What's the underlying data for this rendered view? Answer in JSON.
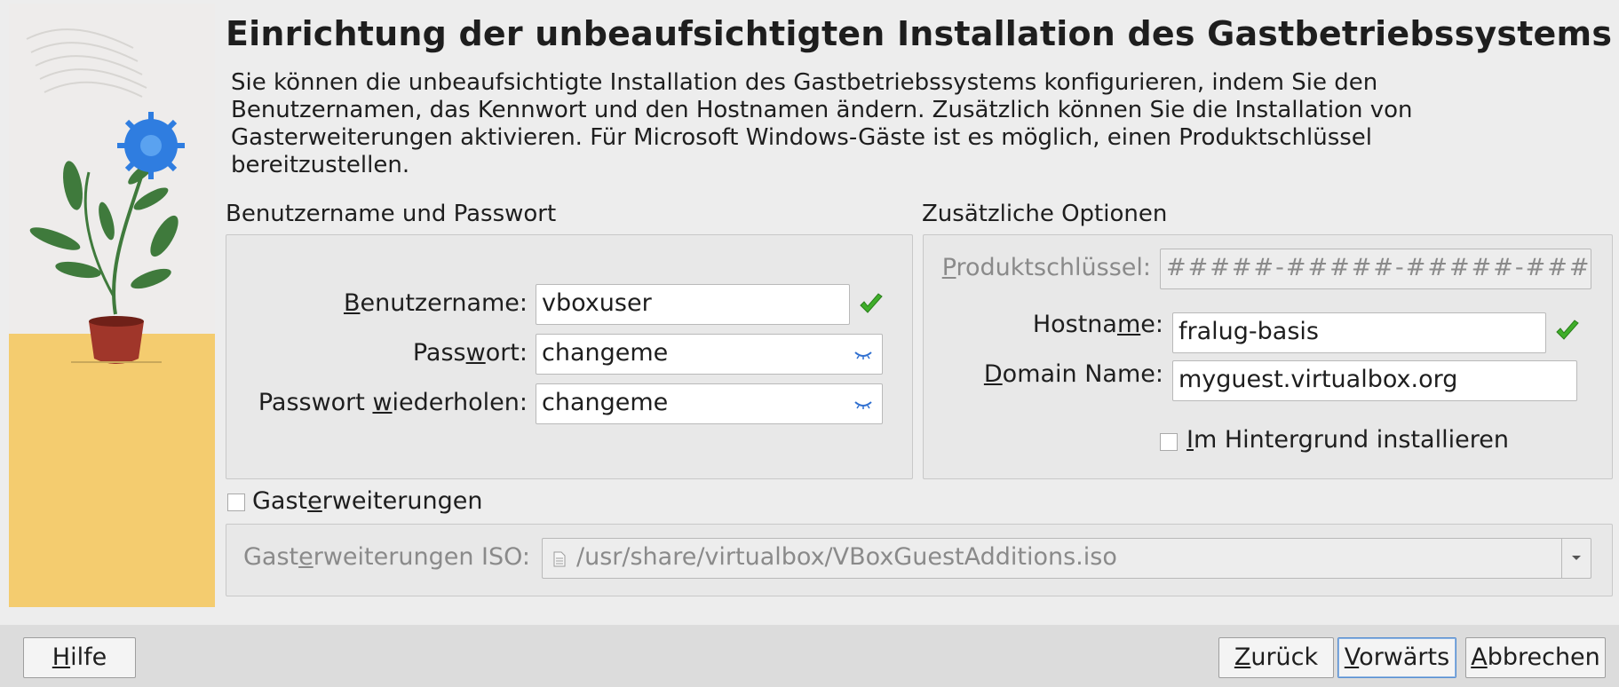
{
  "header": {
    "title": "Einrichtung der unbeaufsichtigten Installation des Gastbetriebssystems",
    "description": "Sie können die unbeaufsichtigte Installation des Gastbetriebssystems konfigurieren, indem Sie den Benutzernamen, das Kennwort und den Hostnamen ändern. Zusätzlich können Sie die Installation von Gasterweiterungen aktivieren. Für Microsoft Windows-Gäste ist es möglich, einen Produktschlüssel bereitzustellen."
  },
  "credentials": {
    "section_label": "Benutzername und Passwort",
    "username_label_prefix": "",
    "username_label_mnemonic": "B",
    "username_label_rest": "enutzername:",
    "username_value": "vboxuser",
    "password_label_prefix": "Pass",
    "password_label_mnemonic": "w",
    "password_label_rest": "ort:",
    "password_value": "changeme",
    "repeat_label_prefix": "Passwort ",
    "repeat_label_mnemonic": "w",
    "repeat_label_rest": "iederholen:",
    "repeat_value": "changeme"
  },
  "options": {
    "section_label": "Zusätzliche Optionen",
    "product_key_label_prefix": "",
    "product_key_label_mnemonic": "P",
    "product_key_label_rest": "roduktschlüssel:",
    "product_key_placeholder": "#####-#####-#####-#####-#####",
    "hostname_label_prefix": "Hostna",
    "hostname_label_mnemonic": "m",
    "hostname_label_rest": "e:",
    "hostname_value": "fralug-basis",
    "domain_label_prefix": "",
    "domain_label_mnemonic": "D",
    "domain_label_rest": "omain Name:",
    "domain_value": "myguest.virtualbox.org",
    "background_label_prefix": "",
    "background_label_mnemonic": "I",
    "background_label_rest": "m Hintergrund installieren",
    "background_checked": false
  },
  "guest_additions": {
    "checkbox_label_prefix": "Gast",
    "checkbox_label_mnemonic": "e",
    "checkbox_label_rest": "rweiterungen",
    "checked": false,
    "iso_label_prefix": "Gast",
    "iso_label_mnemonic": "e",
    "iso_label_rest": "rweiterungen ISO:",
    "iso_path": "/usr/share/virtualbox/VBoxGuestAdditions.iso"
  },
  "footer": {
    "help_mnemonic": "H",
    "help_rest": "ilfe",
    "back_mnemonic": "Z",
    "back_rest": "urück",
    "next_mnemonic": "V",
    "next_rest": "orwärts",
    "cancel_mnemonic": "A",
    "cancel_rest": "bbrechen"
  },
  "colors": {
    "valid_check": "#3fae2a",
    "illustration_yellow": "#f4cc6f",
    "flower_blue": "#2f7de0",
    "leaf_green": "#3f7a3c",
    "pot_red": "#a0362a"
  },
  "icons": {
    "valid": "check-icon",
    "password_reveal": "eye-closed-icon",
    "file": "file-icon",
    "dropdown": "chevron-down-icon"
  }
}
